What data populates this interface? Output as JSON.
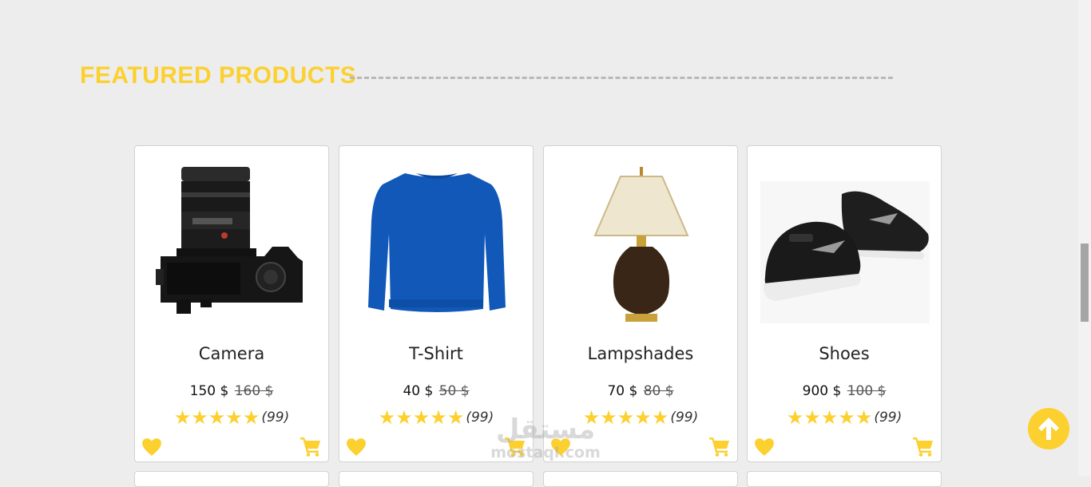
{
  "section": {
    "title": "FEATURED PRODUCTS"
  },
  "products": [
    {
      "name": "Camera",
      "price": "150 $",
      "old_price": "160 $",
      "rating_count": "(99)",
      "rating": 5
    },
    {
      "name": "T-Shirt",
      "price": "40 $",
      "old_price": "50 $",
      "rating_count": "(99)",
      "rating": 5
    },
    {
      "name": "Lampshades",
      "price": "70 $",
      "old_price": "80 $",
      "rating_count": "(99)",
      "rating": 5
    },
    {
      "name": "Shoes",
      "price": "900 $",
      "old_price": "100 $",
      "rating_count": "(99)",
      "rating": 5
    }
  ],
  "stars_text": "★★★★★",
  "watermark": {
    "main": "مستقل",
    "sub": "mostaql.com"
  },
  "icons": [
    "heart-icon",
    "cart-icon",
    "arrow-up-icon",
    "star-icon",
    "camera-image",
    "sweater-image",
    "lamp-image",
    "shoes-image"
  ],
  "colors": {
    "accent": "#fcd02f",
    "background": "#ededed",
    "card": "#ffffff"
  }
}
